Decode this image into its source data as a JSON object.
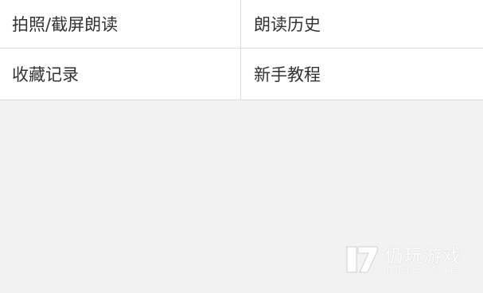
{
  "menu": {
    "items": [
      {
        "label": "拍照/截屏朗读"
      },
      {
        "label": "朗读历史"
      },
      {
        "label": "收藏记录"
      },
      {
        "label": "新手教程"
      }
    ]
  },
  "watermark": {
    "title": "仍玩游戏",
    "subtitle": "Rengwan Games",
    "logo_icon": "rengwan-logo-icon"
  },
  "colors": {
    "page_background": "#f2f2f2",
    "menu_background": "#ffffff",
    "divider": "#dcdcdc",
    "text": "#333333"
  }
}
